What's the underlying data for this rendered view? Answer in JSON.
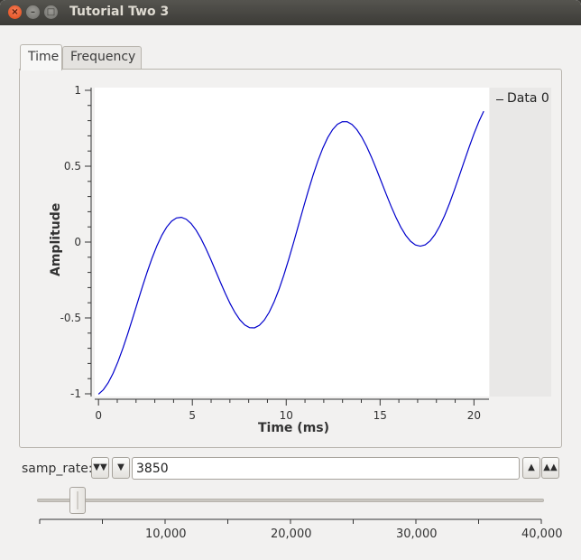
{
  "window": {
    "title": "Tutorial Two 3",
    "close_glyph": "×",
    "min_glyph": "–",
    "max_glyph": "□"
  },
  "tabs": [
    {
      "label": "Time"
    },
    {
      "label": "Frequency"
    }
  ],
  "chart_data": {
    "type": "line",
    "xlabel": "Time (ms)",
    "ylabel": "Amplitude",
    "xlim": [
      -0.2,
      20.8
    ],
    "ylim": [
      -1,
      1
    ],
    "x_ticks": [
      0,
      5,
      10,
      15,
      20
    ],
    "y_ticks": [
      1,
      0.5,
      0,
      -0.5,
      -1
    ],
    "y_tick_labels": [
      "1",
      "0.5",
      "0",
      "-0.5",
      "-1"
    ],
    "legend": "top-right",
    "series": [
      {
        "name": "Data 0",
        "color": "#0000cc",
        "sample_rate_hz": 3850,
        "points": 80,
        "shape": "beat of two sinusoids, envelope nulls near 3.2 ms, 10.4 ms, 17.6 ms, peaks near 6.8 ms and 14 ms"
      }
    ]
  },
  "controls": {
    "samp_rate_label": "samp_rate:",
    "samp_rate_value": "3850",
    "slider_ticks": [
      "10,000",
      "20,000",
      "30,000",
      "40,000"
    ],
    "slider_value": 3850,
    "slider_min": 0,
    "slider_max": 40000
  }
}
